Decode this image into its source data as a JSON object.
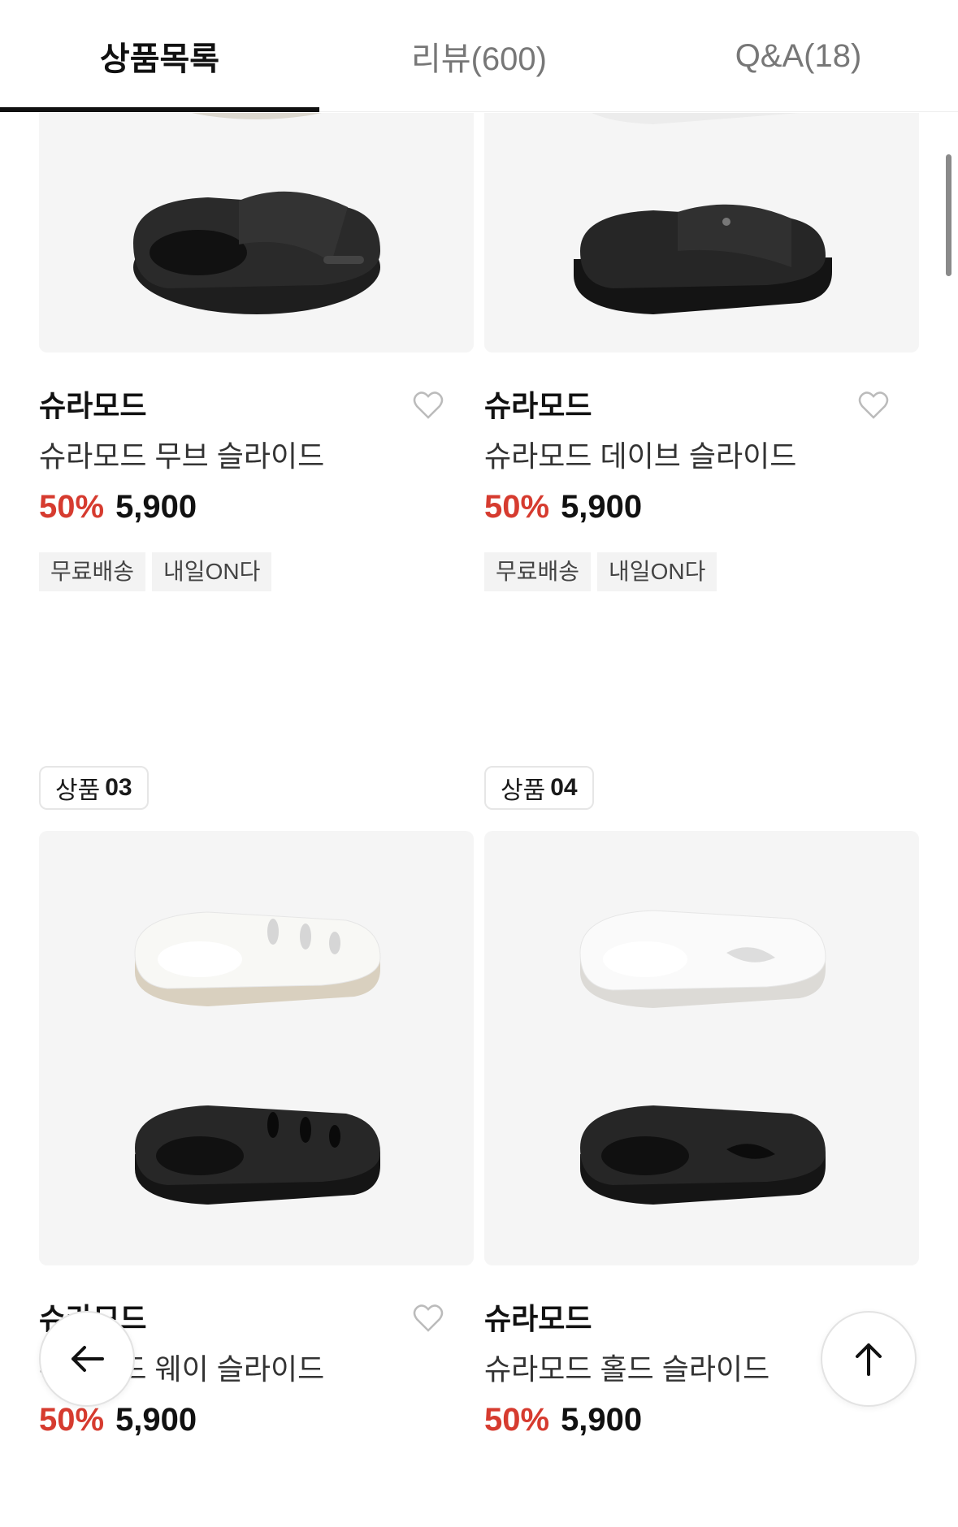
{
  "tabs": [
    {
      "label": "상품목록",
      "active": true
    },
    {
      "label": "리뷰(600)",
      "active": false
    },
    {
      "label": "Q&A(18)",
      "active": false
    }
  ],
  "colors": {
    "discount": "#d63b2f",
    "tab_indicator": "#111111",
    "thumb_bg": "#f5f5f5",
    "tag_bg": "#f3f3f3"
  },
  "products": [
    {
      "badge_label": "",
      "badge_num": "",
      "brand": "슈라모드",
      "name": "슈라모드 무브 슬라이드",
      "discount": "50%",
      "price": "5,900",
      "tags": [
        "무료배송",
        "내일ON다"
      ],
      "image": "beige-and-black-slides"
    },
    {
      "badge_label": "",
      "badge_num": "",
      "brand": "슈라모드",
      "name": "슈라모드 데이브 슬라이드",
      "discount": "50%",
      "price": "5,900",
      "tags": [
        "무료배송",
        "내일ON다"
      ],
      "image": "white-and-black-platform-slides"
    },
    {
      "badge_label": "상품",
      "badge_num": "03",
      "brand": "슈라모드",
      "name": "슈라모드 웨이 슬라이드",
      "discount": "50%",
      "price": "5,900",
      "tags": [],
      "image": "white-and-black-vented-slides"
    },
    {
      "badge_label": "상품",
      "badge_num": "04",
      "brand": "슈라모드",
      "name": "슈라모드 홀드 슬라이드",
      "discount": "50%",
      "price": "5,900",
      "tags": [],
      "image": "white-and-black-cutout-slides"
    }
  ],
  "buttons": {
    "back_icon": "arrow-left-icon",
    "top_icon": "arrow-up-icon"
  }
}
